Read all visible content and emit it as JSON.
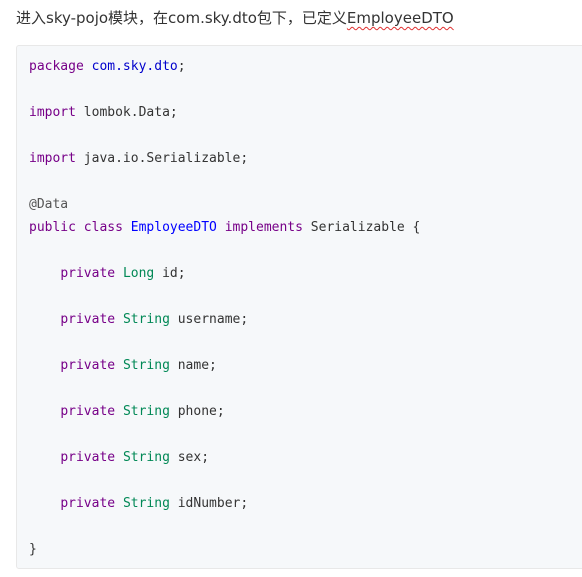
{
  "intro": {
    "prefix": "进入sky-pojo模块，在com.sky.dto包下，已定义",
    "highlight": "EmployeeDTO"
  },
  "code": {
    "package_kw": "package",
    "package_name": "com.sky.dto",
    "semicolon": ";",
    "import_kw": "import",
    "import1": "lombok.Data;",
    "import2": "java.io.Serializable;",
    "annotation": "@Data",
    "public_kw": "public",
    "class_kw": "class",
    "class_name": "EmployeeDTO",
    "implements_kw": "implements",
    "interface_name": "Serializable",
    "open_brace": "{",
    "close_brace": "}",
    "fields": [
      {
        "modifier": "private",
        "type": "Long",
        "name": "id;"
      },
      {
        "modifier": "private",
        "type": "String",
        "name": "username;"
      },
      {
        "modifier": "private",
        "type": "String",
        "name": "name;"
      },
      {
        "modifier": "private",
        "type": "String",
        "name": "phone;"
      },
      {
        "modifier": "private",
        "type": "String",
        "name": "sex;"
      },
      {
        "modifier": "private",
        "type": "String",
        "name": "idNumber;"
      }
    ]
  },
  "colors": {
    "keyword": "#770088",
    "package": "#0000cc",
    "type": "#008855",
    "class_name": "#0000ff",
    "background": "#f6f8fa"
  }
}
